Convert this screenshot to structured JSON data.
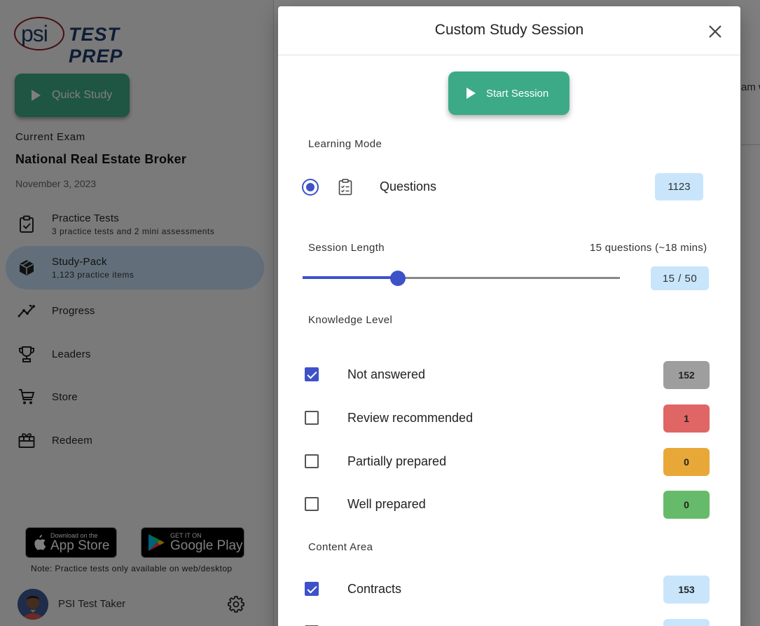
{
  "brand": {
    "logo_mark": "psi",
    "logo_text": "TEST PREP"
  },
  "sidebar": {
    "quick_study_label": "Quick Study",
    "current_exam_label": "Current Exam",
    "exam_name": "National Real Estate Broker",
    "exam_date": "November 3, 2023",
    "nav": [
      {
        "label": "Practice Tests",
        "sub": "3 practice tests and 2 mini assessments",
        "icon": "clipboard-check-icon"
      },
      {
        "label": "Study-Pack",
        "sub": "1,123 practice items",
        "icon": "cube-icon"
      },
      {
        "label": "Progress",
        "icon": "trend-chart-icon"
      },
      {
        "label": "Leaders",
        "icon": "trophy-icon"
      },
      {
        "label": "Store",
        "icon": "cart-icon"
      },
      {
        "label": "Redeem",
        "icon": "gift-icon"
      }
    ],
    "active_item": "Study-Pack",
    "app_store": {
      "small": "Download on the",
      "big": "App Store"
    },
    "google_play": {
      "small": "GET IT ON",
      "big": "Google Play"
    },
    "note": "Note: Practice tests only available on web/desktop",
    "user_name": "PSI Test Taker"
  },
  "main": {
    "peek_text": "am w"
  },
  "modal": {
    "title": "Custom Study Session",
    "start_label": "Start Session",
    "learning_mode_label": "Learning Mode",
    "mode": {
      "label": "Questions",
      "count": "1123",
      "selected": true
    },
    "session_length_label": "Session Length",
    "session_length_summary": "15 questions (~18 mins)",
    "slider": {
      "value": 15,
      "max": 50,
      "display": "15 / 50"
    },
    "knowledge_level_label": "Knowledge Level",
    "knowledge_levels": [
      {
        "label": "Not answered",
        "count": "152",
        "checked": true,
        "color": "#9e9e9e"
      },
      {
        "label": "Review recommended",
        "count": "1",
        "checked": false,
        "color": "#e06666"
      },
      {
        "label": "Partially prepared",
        "count": "0",
        "checked": false,
        "color": "#e8a838"
      },
      {
        "label": "Well prepared",
        "count": "0",
        "checked": false,
        "color": "#66bb6a"
      }
    ],
    "content_area_label": "Content Area",
    "content_areas": [
      {
        "label": "Contracts",
        "count": "153",
        "checked": true,
        "color": "#c9e5fb"
      }
    ]
  },
  "colors": {
    "accent_green": "#3daa87",
    "accent_blue": "#3d52c8",
    "active_nav_bg": "#c5dff4",
    "badge_blue": "#c9e5fb"
  }
}
